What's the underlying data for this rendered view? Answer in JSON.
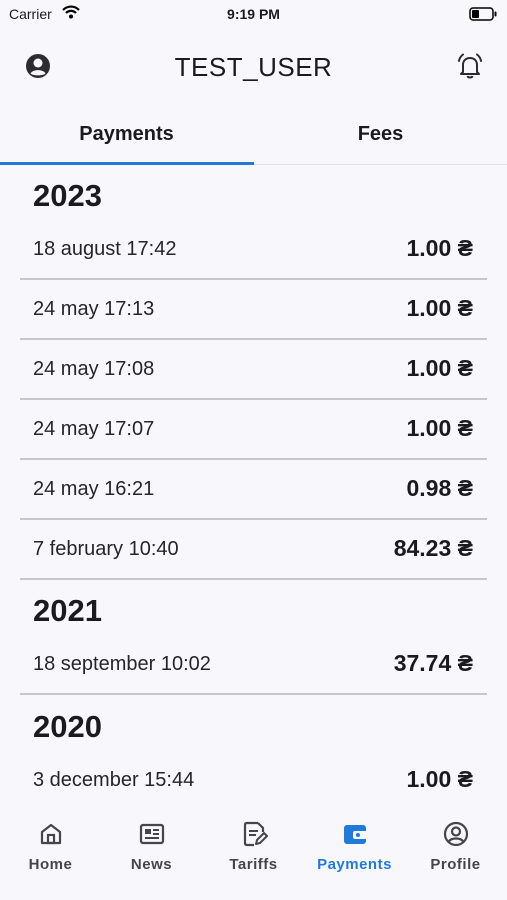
{
  "status_bar": {
    "carrier": "Carrier",
    "time": "9:19 PM"
  },
  "header": {
    "title": "TEST_USER"
  },
  "tabs": [
    {
      "label": "Payments",
      "active": true
    },
    {
      "label": "Fees",
      "active": false
    }
  ],
  "groups": [
    {
      "year": "2023",
      "rows": [
        {
          "date": "18 august 17:42",
          "amount": "1.00 ₴"
        },
        {
          "date": "24 may 17:13",
          "amount": "1.00 ₴"
        },
        {
          "date": "24 may 17:08",
          "amount": "1.00 ₴"
        },
        {
          "date": "24 may 17:07",
          "amount": "1.00 ₴"
        },
        {
          "date": "24 may 16:21",
          "amount": "0.98 ₴"
        },
        {
          "date": "7 february 10:40",
          "amount": "84.23 ₴"
        }
      ]
    },
    {
      "year": "2021",
      "rows": [
        {
          "date": "18 september 10:02",
          "amount": "37.74 ₴"
        }
      ]
    },
    {
      "year": "2020",
      "rows": [
        {
          "date": "3 december 15:44",
          "amount": "1.00 ₴"
        }
      ]
    }
  ],
  "nav": [
    {
      "label": "Home",
      "icon": "home-icon",
      "active": false
    },
    {
      "label": "News",
      "icon": "news-icon",
      "active": false
    },
    {
      "label": "Tariffs",
      "icon": "tariffs-icon",
      "active": false
    },
    {
      "label": "Payments",
      "icon": "wallet-icon",
      "active": true
    },
    {
      "label": "Profile",
      "icon": "profile-icon",
      "active": false
    }
  ],
  "colors": {
    "accent": "#1f7ad9",
    "background": "#f8f7fb",
    "divider": "#c8c7cc"
  }
}
